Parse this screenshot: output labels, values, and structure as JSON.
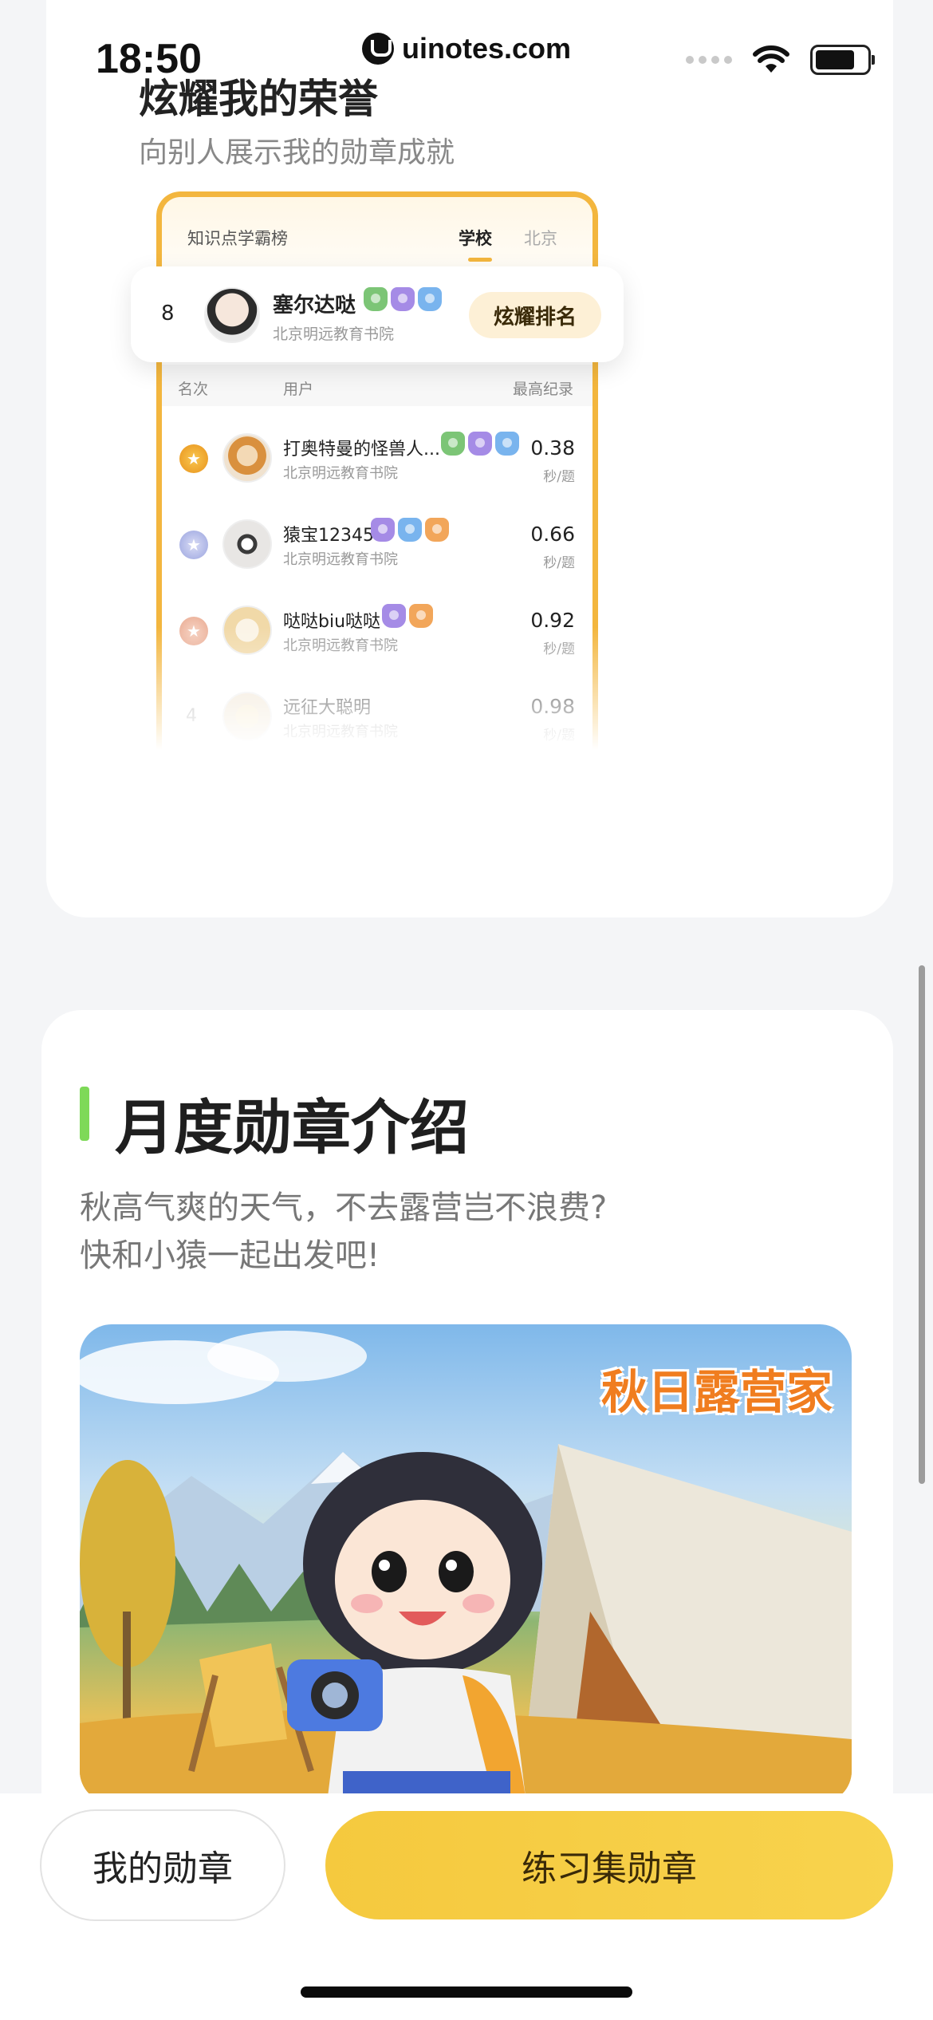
{
  "status_bar": {
    "time": "18:50",
    "url": "uinotes.com",
    "icons": [
      "signal-dots-icon",
      "wifi-icon",
      "battery-icon"
    ]
  },
  "honor_section": {
    "title": "炫耀我的荣誉",
    "subtitle": "向别人展示我的勋章成就",
    "leaderboard": {
      "title": "知识点学霸榜",
      "tabs": [
        {
          "label": "学校",
          "active": true
        },
        {
          "label": "北京",
          "active": false
        }
      ],
      "my_entry": {
        "rank": "8",
        "name": "塞尔达哒",
        "school": "北京明远教育书院",
        "badges": [
          "green-badge-icon",
          "purple-badge-icon",
          "blue-badge-icon"
        ],
        "button": "炫耀排名"
      },
      "columns": [
        "名次",
        "用户",
        "最高纪录"
      ],
      "rows": [
        {
          "rank": "1",
          "medal": "gold-medal-icon",
          "name": "打奥特曼的怪兽人...",
          "school": "北京明远教育书院",
          "score": "0.38",
          "unit": "秒/题",
          "badges": [
            "green-badge-icon",
            "purple-badge-icon",
            "blue-badge-icon"
          ]
        },
        {
          "rank": "2",
          "medal": "silver-medal-icon",
          "name": "猿宝12345",
          "school": "北京明远教育书院",
          "score": "0.66",
          "unit": "秒/题",
          "badges": [
            "purple-badge-icon",
            "blue-badge-icon",
            "orange-badge-icon"
          ]
        },
        {
          "rank": "3",
          "medal": "bronze-medal-icon",
          "name": "哒哒biu哒哒",
          "school": "北京明远教育书院",
          "score": "0.92",
          "unit": "秒/题",
          "badges": [
            "purple-badge-icon",
            "orange-badge-icon"
          ]
        },
        {
          "rank": "4",
          "medal": "",
          "name": "远征大聪明",
          "school": "北京明远教育书院",
          "score": "0.98",
          "unit": "秒/题",
          "badges": []
        }
      ]
    }
  },
  "monthly_section": {
    "title": "月度勋章介绍",
    "description_line1": "秋高气爽的天气，不去露营岂不浪费?",
    "description_line2": "快和小猿一起出发吧!",
    "banner_title": "秋日露营家"
  },
  "bottom_bar": {
    "my_badges_label": "我的勋章",
    "practice_badges_label": "练习集勋章"
  },
  "colors": {
    "accent_yellow": "#f8d34d",
    "board_border": "#f3b63e",
    "accent_green": "#7ed958",
    "banner_title": "#f07d1f"
  }
}
